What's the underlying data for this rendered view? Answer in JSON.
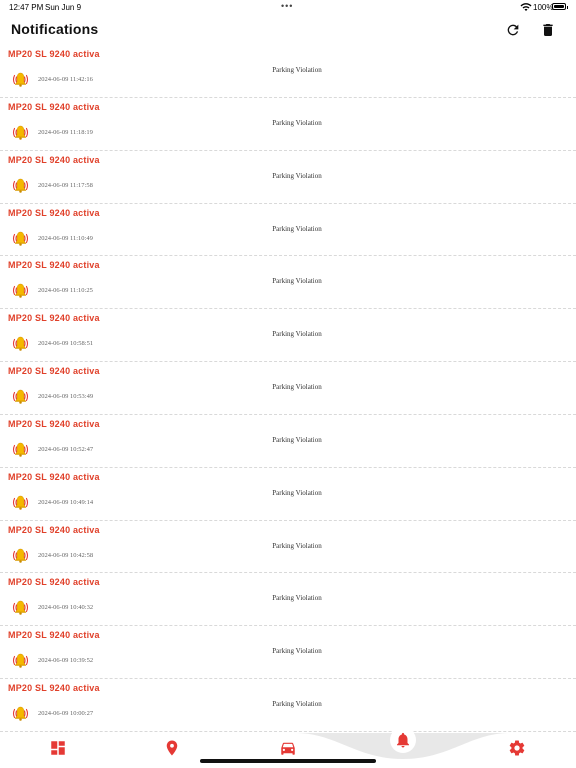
{
  "status_bar": {
    "time": "12:47 PM",
    "date": "Sun Jun 9",
    "battery": "100%"
  },
  "header": {
    "title": "Notifications",
    "refresh_icon": "refresh-icon",
    "delete_icon": "trash-icon"
  },
  "colors": {
    "accent": "#e53935",
    "plate_text": "#e0402a",
    "bell": "#f5b700"
  },
  "notifications": [
    {
      "plate": "MP20 SL 9240 activa",
      "time": "2024-06-09 11:42:16",
      "message": "Parking Violation"
    },
    {
      "plate": "MP20 SL 9240 activa",
      "time": "2024-06-09 11:18:19",
      "message": "Parking Violation"
    },
    {
      "plate": "MP20 SL 9240 activa",
      "time": "2024-06-09 11:17:58",
      "message": "Parking Violation"
    },
    {
      "plate": "MP20 SL 9240 activa",
      "time": "2024-06-09 11:10:49",
      "message": "Parking Violation"
    },
    {
      "plate": "MP20 SL 9240 activa",
      "time": "2024-06-09 11:10:25",
      "message": "Parking Violation"
    },
    {
      "plate": "MP20 SL 9240 activa",
      "time": "2024-06-09 10:58:51",
      "message": "Parking Violation"
    },
    {
      "plate": "MP20 SL 9240 activa",
      "time": "2024-06-09 10:53:49",
      "message": "Parking Violation"
    },
    {
      "plate": "MP20 SL 9240 activa",
      "time": "2024-06-09 10:52:47",
      "message": "Parking Violation"
    },
    {
      "plate": "MP20 SL 9240 activa",
      "time": "2024-06-09 10:49:14",
      "message": "Parking Violation"
    },
    {
      "plate": "MP20 SL 9240 activa",
      "time": "2024-06-09 10:42:58",
      "message": "Parking Violation"
    },
    {
      "plate": "MP20 SL 9240 activa",
      "time": "2024-06-09 10:40:32",
      "message": "Parking Violation"
    },
    {
      "plate": "MP20 SL 9240 activa",
      "time": "2024-06-09 10:39:52",
      "message": "Parking Violation"
    },
    {
      "plate": "MP20 SL 9240 activa",
      "time": "2024-06-09 10:00:27",
      "message": "Parking Violation"
    }
  ],
  "tabbar": {
    "tabs": [
      {
        "icon": "dashboard-icon",
        "active": false
      },
      {
        "icon": "location-pin-icon",
        "active": false
      },
      {
        "icon": "car-icon",
        "active": false
      },
      {
        "icon": "bell-icon",
        "active": true
      },
      {
        "icon": "gear-icon",
        "active": false
      }
    ]
  }
}
